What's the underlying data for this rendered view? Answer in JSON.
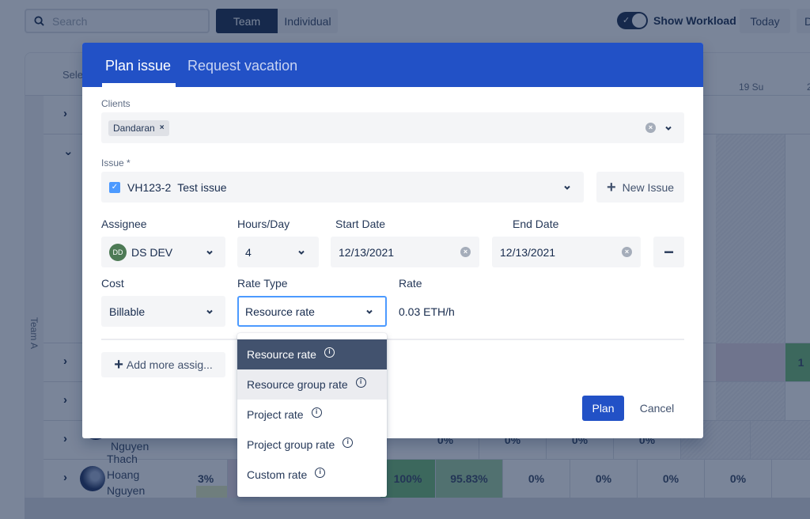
{
  "background": {
    "search": {
      "placeholder": "Search"
    },
    "view_toggle": {
      "team": "Team",
      "individual": "Individual",
      "active": "Team"
    },
    "workload_toggle": {
      "label": "Show Workload",
      "checked": true
    },
    "today_label": "Today",
    "next_label": "D",
    "grid": {
      "select_label": "Sele",
      "days": [
        "19 Su",
        "2"
      ],
      "team_label": "Team A",
      "rows": [
        {
          "name_lines": [
            "Nguyen"
          ],
          "cells": [
            "0%",
            "0%",
            "0%",
            "0%"
          ]
        },
        {
          "name_lines": [
            "Thach",
            "Hoang",
            "Nguyen"
          ],
          "cells": [
            "3%",
            "100%",
            "95.83%",
            "0%",
            "0%",
            "0%",
            "0%"
          ]
        }
      ],
      "partial_value": "1"
    }
  },
  "modal": {
    "tabs": [
      {
        "label": "Plan issue",
        "active": true
      },
      {
        "label": "Request vacation",
        "active": false
      }
    ],
    "clients": {
      "label": "Clients",
      "chips": [
        "Dandaran"
      ],
      "chip_remove": "×"
    },
    "issue": {
      "label": "Issue *",
      "key": "VH123-2",
      "summary": "Test issue",
      "new_issue_label": "New Issue"
    },
    "assignee": {
      "label": "Assignee",
      "initials": "DD",
      "value": "DS DEV"
    },
    "hours_per_day": {
      "label": "Hours/Day",
      "value": "4"
    },
    "start_date": {
      "label": "Start Date",
      "value": "12/13/2021"
    },
    "end_date": {
      "label": "End Date",
      "value": "12/13/2021"
    },
    "remove_label": "−",
    "cost": {
      "label": "Cost",
      "value": "Billable"
    },
    "rate_type": {
      "label": "Rate Type",
      "value": "Resource rate",
      "options": [
        {
          "label": "Resource rate",
          "state": "selected"
        },
        {
          "label": "Resource group rate",
          "state": "hover"
        },
        {
          "label": "Project rate",
          "state": ""
        },
        {
          "label": "Project group rate",
          "state": ""
        },
        {
          "label": "Custom rate",
          "state": ""
        }
      ]
    },
    "rate": {
      "label": "Rate",
      "value": "0.03 ETH/h"
    },
    "add_more_label": "Add more assig...",
    "plan_label": "Plan",
    "cancel_label": "Cancel"
  },
  "colors": {
    "primary": "#2251c6",
    "selected_option": "#42526e",
    "focus_border": "#4c9aff",
    "avatar_bg": "#4d7a55"
  }
}
